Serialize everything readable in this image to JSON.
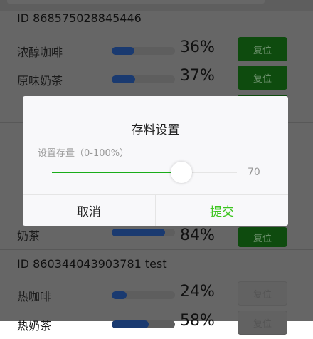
{
  "devices": [
    {
      "id": "ID 868575028845446",
      "rows": [
        {
          "name": "浓醇咖啡",
          "percent": 36,
          "pct_label": "36%",
          "button": "复位",
          "enabled": true
        },
        {
          "name": "原味奶茶",
          "percent": 37,
          "pct_label": "37%",
          "button": "复位",
          "enabled": true
        }
      ]
    },
    {
      "rows": [
        {
          "name": "奶茶",
          "percent": 84,
          "pct_label": "84%",
          "button": "复位",
          "enabled": true
        }
      ]
    },
    {
      "id": "ID 860344043903781 test",
      "rows": [
        {
          "name": "热咖啡",
          "percent": 24,
          "pct_label": "24%",
          "button": "复位",
          "enabled": false
        },
        {
          "name": "热奶茶",
          "percent": 58,
          "pct_label": "58%",
          "button": "复位",
          "enabled": false
        }
      ]
    }
  ],
  "modal": {
    "title": "存料设置",
    "hint": "设置存量（0-100%）",
    "value": 70,
    "value_label": "70",
    "cancel": "取消",
    "submit": "提交"
  },
  "colors": {
    "accent": "#1aad19",
    "bar": "#2d5fb8"
  }
}
